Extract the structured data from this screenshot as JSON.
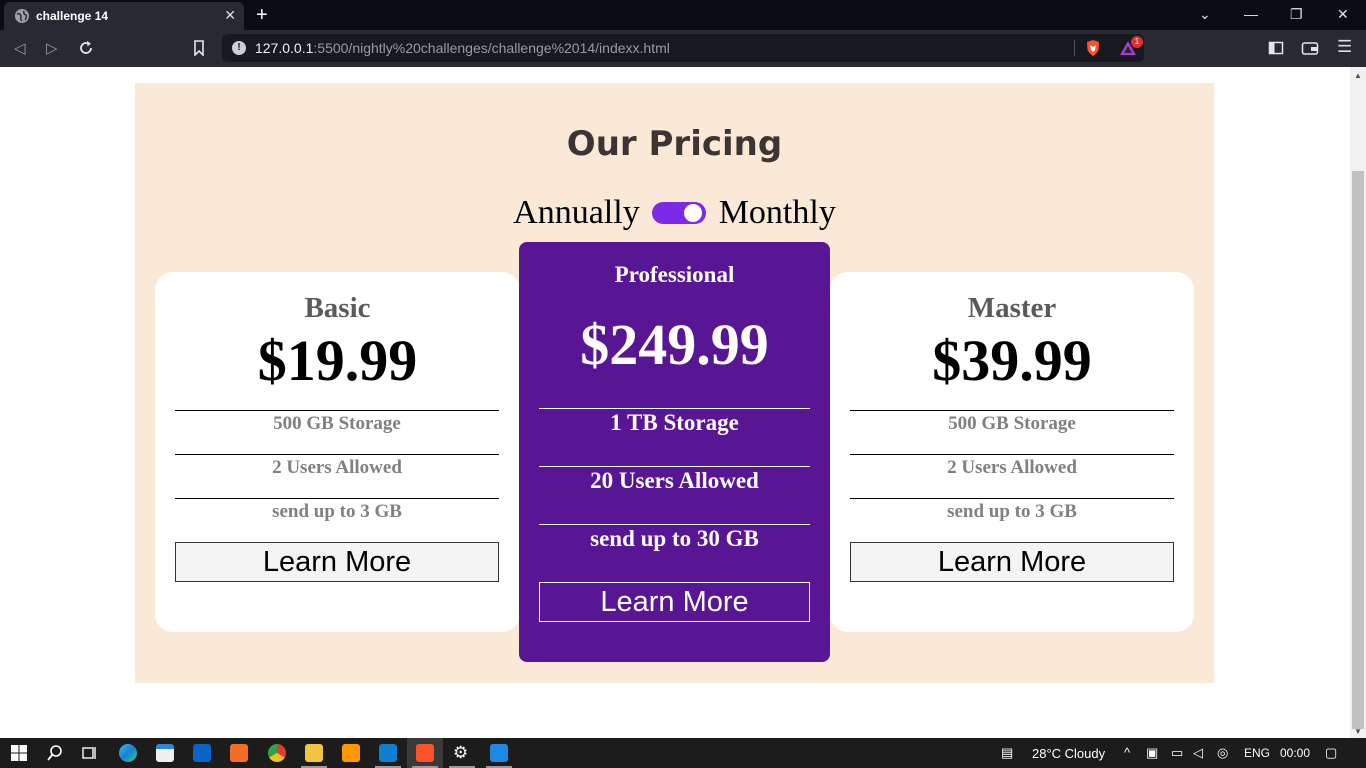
{
  "browser": {
    "tab_title": "challenge 14",
    "tab_close": "✕",
    "new_tab": "+",
    "url_host": "127.0.0.1",
    "url_rest": ":5500/nightly%20challenges/challenge%2014/indexx.html",
    "rewards_badge": "1",
    "window_controls": [
      "⌄",
      "—",
      "❐",
      "✕"
    ]
  },
  "page": {
    "heading": "Our Pricing",
    "toggle": {
      "left_label": "Annually",
      "right_label": "Monthly",
      "state": "on"
    },
    "plans": [
      {
        "name": "Basic",
        "price": "$19.99",
        "features": [
          "500 GB Storage",
          "2 Users Allowed",
          "send up to 3 GB"
        ],
        "button": "Learn More"
      },
      {
        "name": "Professional",
        "price": "$249.99",
        "features": [
          "1 TB Storage",
          "20 Users Allowed",
          "send up to 30 GB"
        ],
        "button": "Learn More"
      },
      {
        "name": "Master",
        "price": "$39.99",
        "features": [
          "500 GB Storage",
          "2 Users Allowed",
          "send up to 3 GB"
        ],
        "button": "Learn More"
      }
    ]
  },
  "taskbar": {
    "weather": "28°C  Cloudy",
    "language": "ENG",
    "time": "00:00"
  },
  "colors": {
    "section_bg": "#fae9d7",
    "accent_purple": "#581694",
    "toggle_purple": "#7d2ae8",
    "browser_dark": "#272a33"
  }
}
